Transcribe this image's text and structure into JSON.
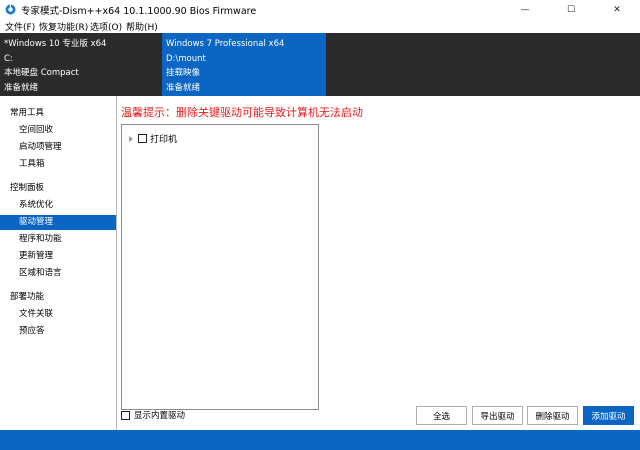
{
  "window": {
    "title": "专家模式-Dism++x64 10.1.1000.90 Bios Firmware",
    "minimize_glyph": "—",
    "maximize_glyph": "☐",
    "close_glyph": "✕"
  },
  "menu": {
    "items": [
      "文件(F)",
      "恢复功能(R)",
      "选项(O)",
      "帮助(H)"
    ]
  },
  "images": [
    {
      "name": "*Windows 10 专业版 x64",
      "path": "C:",
      "type": "本地硬盘 Compact",
      "status": "准备就绪"
    },
    {
      "name": "Windows 7 Professional x64",
      "path": "D:\\mount",
      "type": "挂载映像",
      "status": "准备就绪"
    }
  ],
  "sidebar": {
    "groups": [
      {
        "title": "常用工具",
        "items": [
          "空间回收",
          "启动项管理",
          "工具箱"
        ]
      },
      {
        "title": "控制面板",
        "items": [
          "系统优化",
          "驱动管理",
          "程序和功能",
          "更新管理",
          "区域和语言"
        ]
      },
      {
        "title": "部署功能",
        "items": [
          "文件关联",
          "预应答"
        ]
      }
    ],
    "active": "驱动管理"
  },
  "content": {
    "warning": "温馨提示：删除关键驱动可能导致计算机无法启动",
    "tree": [
      {
        "label": "打印机",
        "checked": false,
        "expanded": false
      }
    ],
    "show_builtin_label": "显示内置驱动",
    "buttons": {
      "select_all": "全选",
      "export": "导出驱动",
      "delete": "删除驱动",
      "add": "添加驱动"
    }
  },
  "colors": {
    "accent": "#0a66c2",
    "dark_strip": "#2b2b2b",
    "warning": "#e81b1b"
  }
}
